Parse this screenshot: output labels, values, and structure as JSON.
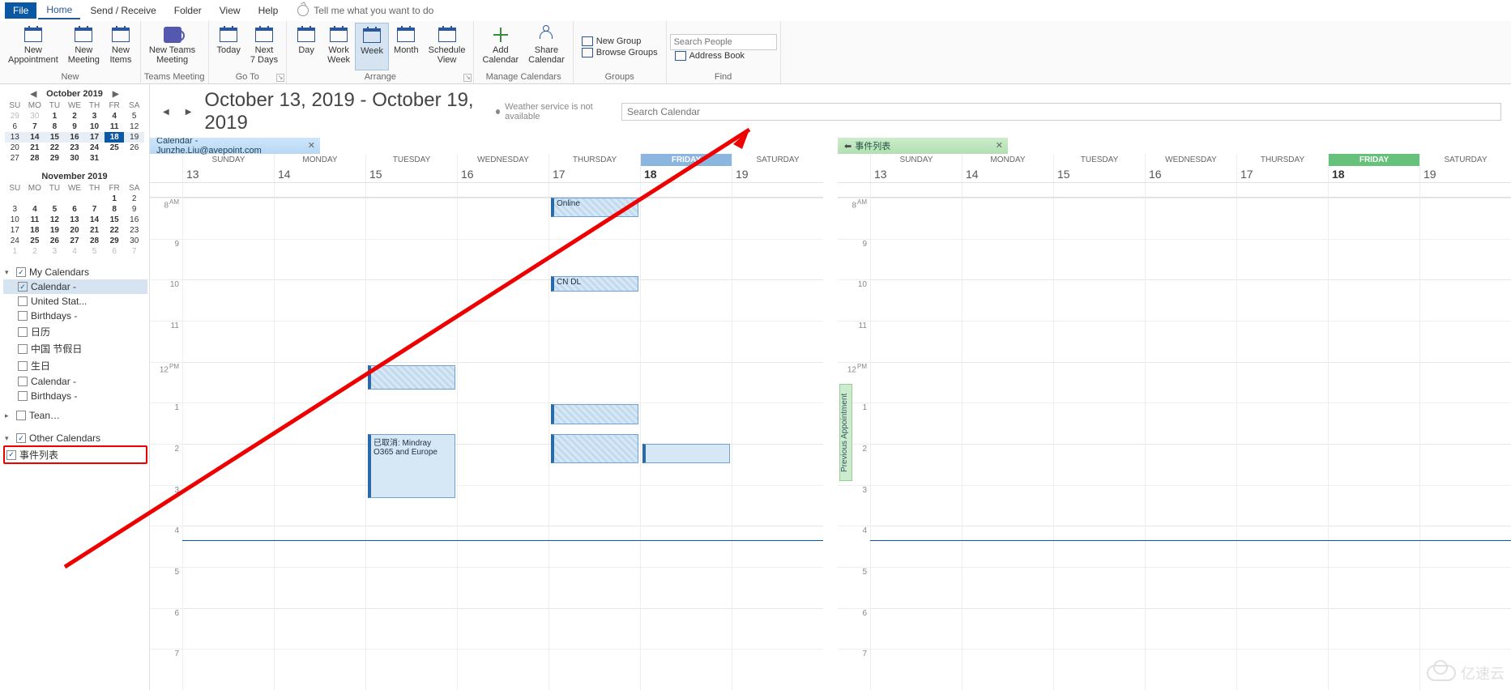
{
  "menu": {
    "file": "File",
    "home": "Home",
    "sendreceive": "Send / Receive",
    "folder": "Folder",
    "view": "View",
    "help": "Help",
    "tellme": "Tell me what you want to do"
  },
  "ribbon": {
    "new": {
      "label": "New",
      "new_appointment": "New\nAppointment",
      "new_meeting": "New\nMeeting",
      "new_items": "New\nItems"
    },
    "teams": {
      "label": "Teams Meeting",
      "btn": "New Teams\nMeeting"
    },
    "goto": {
      "label": "Go To",
      "today": "Today",
      "next7": "Next\n7 Days"
    },
    "arrange": {
      "label": "Arrange",
      "day": "Day",
      "workweek": "Work\nWeek",
      "week": "Week",
      "month": "Month",
      "schedule": "Schedule\nView"
    },
    "manage": {
      "label": "Manage Calendars",
      "add": "Add\nCalendar",
      "share": "Share\nCalendar"
    },
    "groups": {
      "label": "Groups",
      "new": "New Group",
      "browse": "Browse Groups"
    },
    "find": {
      "label": "Find",
      "placeholder": "Search People",
      "addressbook": "Address Book"
    }
  },
  "dateheader": {
    "range": "October 13, 2019 - October 19, 2019",
    "weather": "Weather service is not available",
    "search_placeholder": "Search Calendar"
  },
  "month1": {
    "title": "October 2019",
    "dow": [
      "SU",
      "MO",
      "TU",
      "WE",
      "TH",
      "FR",
      "SA"
    ],
    "cells": [
      {
        "n": "29",
        "out": 1
      },
      {
        "n": "30",
        "out": 1
      },
      {
        "n": "1",
        "bold": 1
      },
      {
        "n": "2",
        "bold": 1
      },
      {
        "n": "3",
        "bold": 1
      },
      {
        "n": "4",
        "bold": 1
      },
      {
        "n": "5"
      },
      {
        "n": "6"
      },
      {
        "n": "7",
        "bold": 1
      },
      {
        "n": "8",
        "bold": 1
      },
      {
        "n": "9",
        "bold": 1
      },
      {
        "n": "10",
        "bold": 1
      },
      {
        "n": "11",
        "bold": 1
      },
      {
        "n": "12"
      },
      {
        "n": "13",
        "wk": 1
      },
      {
        "n": "14",
        "wk": 1,
        "bold": 1
      },
      {
        "n": "15",
        "wk": 1,
        "bold": 1
      },
      {
        "n": "16",
        "wk": 1,
        "bold": 1
      },
      {
        "n": "17",
        "wk": 1,
        "bold": 1
      },
      {
        "n": "18",
        "today": 1
      },
      {
        "n": "19",
        "wk": 1
      },
      {
        "n": "20"
      },
      {
        "n": "21",
        "bold": 1
      },
      {
        "n": "22",
        "bold": 1
      },
      {
        "n": "23",
        "bold": 1
      },
      {
        "n": "24",
        "bold": 1
      },
      {
        "n": "25",
        "bold": 1
      },
      {
        "n": "26"
      },
      {
        "n": "27"
      },
      {
        "n": "28",
        "bold": 1
      },
      {
        "n": "29",
        "bold": 1
      },
      {
        "n": "30",
        "bold": 1
      },
      {
        "n": "31",
        "bold": 1
      },
      {
        "n": "",
        "out": 1
      },
      {
        "n": "",
        "out": 1
      }
    ]
  },
  "month2": {
    "title": "November 2019",
    "dow": [
      "SU",
      "MO",
      "TU",
      "WE",
      "TH",
      "FR",
      "SA"
    ],
    "cells": [
      {
        "n": "",
        "out": 1
      },
      {
        "n": "",
        "out": 1
      },
      {
        "n": "",
        "out": 1
      },
      {
        "n": "",
        "out": 1
      },
      {
        "n": "",
        "out": 1
      },
      {
        "n": "1",
        "bold": 1
      },
      {
        "n": "2"
      },
      {
        "n": "3"
      },
      {
        "n": "4",
        "bold": 1
      },
      {
        "n": "5",
        "bold": 1
      },
      {
        "n": "6",
        "bold": 1
      },
      {
        "n": "7",
        "bold": 1
      },
      {
        "n": "8",
        "bold": 1
      },
      {
        "n": "9"
      },
      {
        "n": "10"
      },
      {
        "n": "11",
        "bold": 1
      },
      {
        "n": "12",
        "bold": 1
      },
      {
        "n": "13",
        "bold": 1
      },
      {
        "n": "14",
        "bold": 1
      },
      {
        "n": "15",
        "bold": 1
      },
      {
        "n": "16"
      },
      {
        "n": "17"
      },
      {
        "n": "18",
        "bold": 1
      },
      {
        "n": "19",
        "bold": 1
      },
      {
        "n": "20",
        "bold": 1
      },
      {
        "n": "21",
        "bold": 1
      },
      {
        "n": "22",
        "bold": 1
      },
      {
        "n": "23"
      },
      {
        "n": "24"
      },
      {
        "n": "25",
        "bold": 1
      },
      {
        "n": "26",
        "bold": 1
      },
      {
        "n": "27",
        "bold": 1
      },
      {
        "n": "28",
        "bold": 1
      },
      {
        "n": "29",
        "bold": 1
      },
      {
        "n": "30"
      },
      {
        "n": "1",
        "out": 1
      },
      {
        "n": "2",
        "out": 1
      },
      {
        "n": "3",
        "out": 1
      },
      {
        "n": "4",
        "out": 1
      },
      {
        "n": "5",
        "out": 1
      },
      {
        "n": "6",
        "out": 1
      },
      {
        "n": "7",
        "out": 1
      }
    ]
  },
  "tree": {
    "my_calendars": "My Calendars",
    "items": [
      {
        "label": "Calendar -",
        "checked": true,
        "sel": true
      },
      {
        "label": "United Stat...",
        "checked": false
      },
      {
        "label": "Birthdays -",
        "checked": false
      },
      {
        "label": "日历",
        "checked": false
      },
      {
        "label": "中国 节假日",
        "checked": false
      },
      {
        "label": "生日",
        "checked": false
      },
      {
        "label": "Calendar -",
        "checked": false
      },
      {
        "label": "Birthdays -",
        "checked": false
      }
    ],
    "team": "Tean…",
    "other_calendars": "Other Calendars",
    "event_list": "事件列表"
  },
  "tabs": {
    "left": "Calendar - Junzhe.Liu@avepoint.com",
    "right": "事件列表"
  },
  "days": {
    "names": [
      "SUNDAY",
      "MONDAY",
      "TUESDAY",
      "WEDNESDAY",
      "THURSDAY",
      "FRIDAY",
      "SATURDAY"
    ],
    "nums": [
      "13",
      "14",
      "15",
      "16",
      "17",
      "18",
      "19"
    ]
  },
  "hours": [
    "8 AM",
    "9",
    "10",
    "11",
    "12 PM",
    "1",
    "2",
    "3",
    "4",
    "5",
    "6",
    "7"
  ],
  "events": {
    "thu_online": "Online",
    "thu_cndl": "CN DL",
    "tue_cancel": "已取消: Mindray O365 and Europe"
  },
  "prev_appt": "Previous Appointment",
  "watermark": "亿速云"
}
